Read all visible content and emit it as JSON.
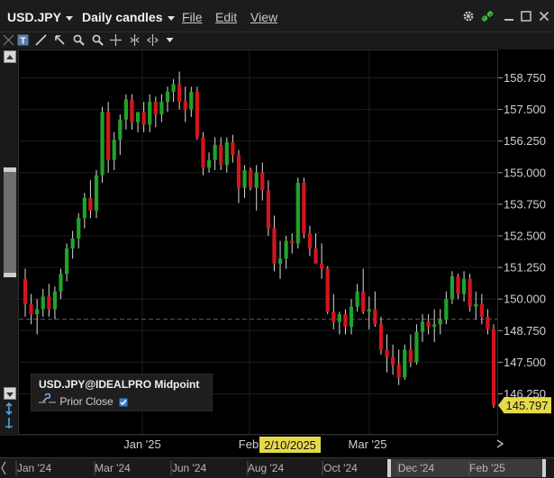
{
  "header": {
    "symbol": "USD.JPY",
    "chart_style": "Daily candles",
    "menu": [
      "File",
      "Edit",
      "View"
    ],
    "icons": [
      "gear-icon",
      "link-icon",
      "minimize-icon",
      "maximize-icon",
      "close-icon"
    ]
  },
  "toolbar": {
    "tools": [
      "text-tool-icon",
      "arrow-tool-icon",
      "zoom-in-icon",
      "zoom-out-icon",
      "crosshair-icon",
      "compress-icon",
      "expand-icon",
      "dropdown-icon"
    ]
  },
  "legend": {
    "title": "USD.JPY@IDEALPRO Midpoint",
    "prior_close": "Prior Close"
  },
  "colors": {
    "up": "#1fa32a",
    "down": "#d4151c",
    "price_label_bg": "#e6d94a",
    "grid": "#1e1e1e"
  },
  "chart_data": {
    "type": "candlestick",
    "y_ticks": [
      146.25,
      147.5,
      148.75,
      150.0,
      151.25,
      152.5,
      153.75,
      155.0,
      156.25,
      157.5,
      158.75
    ],
    "y_tick_labels": [
      "146.250",
      "147.500",
      "148.750",
      "150.000",
      "151.250",
      "152.500",
      "153.750",
      "155.000",
      "156.250",
      "157.500",
      "158.750"
    ],
    "ylim": [
      145.2,
      159.5
    ],
    "x_labels": [
      "Jan '25",
      "Feb",
      "Mar '25"
    ],
    "cursor_date": "2/10/2025",
    "last_price": "145.797",
    "prior_close_value": 149.2,
    "overview_labels": [
      "Jan '24",
      "Mar '24",
      "Jun '24",
      "Aug '24",
      "Oct '24",
      "Dec '24",
      "Feb '25"
    ],
    "candles": [
      [
        150.8,
        151.2,
        149.3,
        149.8
      ],
      [
        149.8,
        150.2,
        149.0,
        149.4
      ],
      [
        149.4,
        150.0,
        148.6,
        149.6
      ],
      [
        149.6,
        150.4,
        149.3,
        150.1
      ],
      [
        150.1,
        150.6,
        149.3,
        149.6
      ],
      [
        149.6,
        150.5,
        149.2,
        150.3
      ],
      [
        150.3,
        151.2,
        150.0,
        151.0
      ],
      [
        151.0,
        152.2,
        150.7,
        152.0
      ],
      [
        152.0,
        152.7,
        151.6,
        152.4
      ],
      [
        152.4,
        153.4,
        152.0,
        153.2
      ],
      [
        153.2,
        154.2,
        152.8,
        154.0
      ],
      [
        154.0,
        154.7,
        153.2,
        153.5
      ],
      [
        153.5,
        155.1,
        153.2,
        154.9
      ],
      [
        154.9,
        157.6,
        154.6,
        157.4
      ],
      [
        157.4,
        157.8,
        155.0,
        155.5
      ],
      [
        155.5,
        156.6,
        155.1,
        156.3
      ],
      [
        156.3,
        157.3,
        155.7,
        157.1
      ],
      [
        157.1,
        158.1,
        156.7,
        157.9
      ],
      [
        157.9,
        158.1,
        156.7,
        157.0
      ],
      [
        157.0,
        157.3,
        156.6,
        157.4
      ],
      [
        157.4,
        157.8,
        156.6,
        156.9
      ],
      [
        156.9,
        158.1,
        156.6,
        157.8
      ],
      [
        157.8,
        158.0,
        156.8,
        157.3
      ],
      [
        157.3,
        158.1,
        157.0,
        157.8
      ],
      [
        157.8,
        158.4,
        157.4,
        158.2
      ],
      [
        158.2,
        158.7,
        157.8,
        158.5
      ],
      [
        158.5,
        159.0,
        157.5,
        157.8
      ],
      [
        157.8,
        158.4,
        157.0,
        157.5
      ],
      [
        157.5,
        158.4,
        157.2,
        158.2
      ],
      [
        158.2,
        158.4,
        156.3,
        156.4
      ],
      [
        156.4,
        156.6,
        154.9,
        155.2
      ],
      [
        155.2,
        155.8,
        155.0,
        155.5
      ],
      [
        155.5,
        156.4,
        155.1,
        156.1
      ],
      [
        156.1,
        156.4,
        155.1,
        155.3
      ],
      [
        155.3,
        156.4,
        155.0,
        156.2
      ],
      [
        156.2,
        156.5,
        155.4,
        155.7
      ],
      [
        155.7,
        155.9,
        153.8,
        154.4
      ],
      [
        154.4,
        155.3,
        154.0,
        155.1
      ],
      [
        155.1,
        155.2,
        154.3,
        154.4
      ],
      [
        154.4,
        155.3,
        153.5,
        155.0
      ],
      [
        155.0,
        155.4,
        153.9,
        154.3
      ],
      [
        154.3,
        154.7,
        152.5,
        152.8
      ],
      [
        152.8,
        153.3,
        151.1,
        151.4
      ],
      [
        151.4,
        152.3,
        150.8,
        151.6
      ],
      [
        151.6,
        152.5,
        151.2,
        152.3
      ],
      [
        152.3,
        152.6,
        151.8,
        152.2
      ],
      [
        152.2,
        154.8,
        152.0,
        154.6
      ],
      [
        154.6,
        154.8,
        152.4,
        152.6
      ],
      [
        152.6,
        152.9,
        151.7,
        152.0
      ],
      [
        152.0,
        152.6,
        151.6,
        151.4
      ],
      [
        151.4,
        152.2,
        150.8,
        151.2
      ],
      [
        151.2,
        151.3,
        149.4,
        149.5
      ],
      [
        149.5,
        150.2,
        148.8,
        149.1
      ],
      [
        149.1,
        149.5,
        148.6,
        149.4
      ],
      [
        149.4,
        149.6,
        148.6,
        148.9
      ],
      [
        148.9,
        150.0,
        148.6,
        149.7
      ],
      [
        149.7,
        150.6,
        149.5,
        150.3
      ],
      [
        150.3,
        151.2,
        149.4,
        149.5
      ],
      [
        149.5,
        150.1,
        148.8,
        149.6
      ],
      [
        149.6,
        150.3,
        148.9,
        149.0
      ],
      [
        149.0,
        149.3,
        147.8,
        148.0
      ],
      [
        148.0,
        148.6,
        147.1,
        147.7
      ],
      [
        147.7,
        148.2,
        147.0,
        147.4
      ],
      [
        147.4,
        148.0,
        146.6,
        146.9
      ],
      [
        146.9,
        148.2,
        146.8,
        148.0
      ],
      [
        148.0,
        148.6,
        147.3,
        147.5
      ],
      [
        147.5,
        149.0,
        147.4,
        148.7
      ],
      [
        148.7,
        149.4,
        148.3,
        149.1
      ],
      [
        149.1,
        149.4,
        148.6,
        148.9
      ],
      [
        148.9,
        149.6,
        148.3,
        149.0
      ],
      [
        149.0,
        149.6,
        148.6,
        149.2
      ],
      [
        149.2,
        150.3,
        149.0,
        150.0
      ],
      [
        150.0,
        151.1,
        149.8,
        150.9
      ],
      [
        150.9,
        151.0,
        150.0,
        150.2
      ],
      [
        150.2,
        151.1,
        149.9,
        150.8
      ],
      [
        150.8,
        151.0,
        149.5,
        149.7
      ],
      [
        149.7,
        150.3,
        149.2,
        149.8
      ],
      [
        149.8,
        150.2,
        149.0,
        149.3
      ],
      [
        149.3,
        149.6,
        148.6,
        148.8
      ],
      [
        148.8,
        149.0,
        145.7,
        145.797
      ]
    ]
  }
}
